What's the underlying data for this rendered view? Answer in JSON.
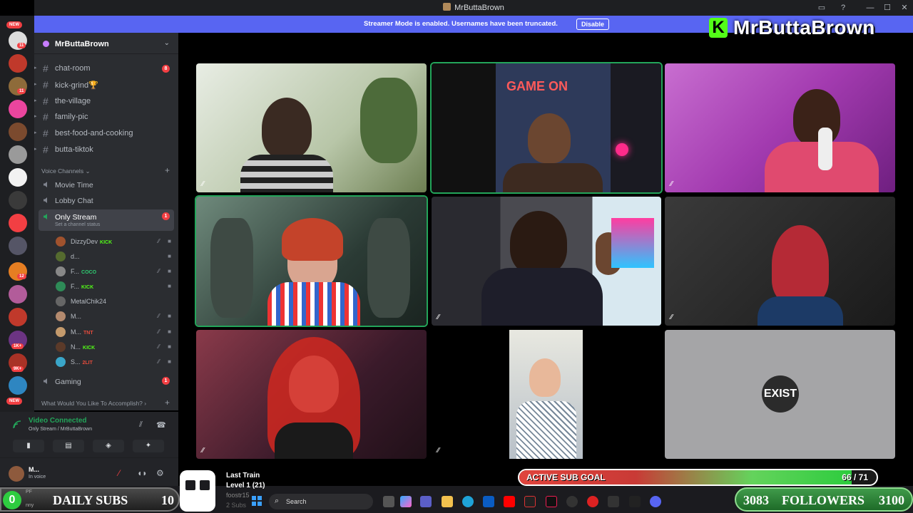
{
  "window": {
    "title": "MrButtaBrown"
  },
  "banner": {
    "message": "Streamer Mode is enabled. Usernames have been truncated.",
    "button": "Disable"
  },
  "brand": {
    "logo_letter": "K",
    "name": "MrButtaBrown",
    "color": "#53fc18"
  },
  "rail": {
    "badges": [
      "NEW",
      "11",
      "11",
      "1",
      "4",
      "5",
      "5",
      "4",
      "8",
      "12",
      "1K+",
      "9K+",
      "NEW"
    ]
  },
  "guild": {
    "name": "MrButtaBrown"
  },
  "text_channels": [
    {
      "name": "chat-room",
      "unread": "8"
    },
    {
      "name": "kick-grind🏆"
    },
    {
      "name": "the-village"
    },
    {
      "name": "family-pic"
    },
    {
      "name": "best-food-and-cooking"
    },
    {
      "name": "butta-tiktok"
    }
  ],
  "voice_category": "Voice Channels",
  "voice_channels": [
    {
      "name": "Movie Time"
    },
    {
      "name": "Lobby Chat"
    },
    {
      "name": "Only Stream",
      "status": "Set a channel status",
      "count": "1"
    }
  ],
  "voice_users": [
    {
      "name": "DizzyDev",
      "tag": "KICK",
      "tag_color": "#53fc18"
    },
    {
      "name": "d...",
      "tag": ""
    },
    {
      "name": "F...",
      "tag": "COCO",
      "tag_color": "#2ecc71"
    },
    {
      "name": "F...",
      "tag": "KICK",
      "tag_color": "#53fc18"
    },
    {
      "name": "MetalChik24",
      "tag": ""
    },
    {
      "name": "M...",
      "tag": ""
    },
    {
      "name": "M...",
      "tag": "TNT",
      "tag_color": "#e74c3c"
    },
    {
      "name": "N...",
      "tag": "KICK",
      "tag_color": "#53fc18"
    },
    {
      "name": "S...",
      "tag": "2LIT",
      "tag_color": "#e74c3c"
    }
  ],
  "gaming_channel": {
    "name": "Gaming",
    "count": "1"
  },
  "accomplish_category": "What Would You Like To Accomplish?",
  "voice_panel": {
    "status": "Video Connected",
    "location": "Only Stream / MrButtaBrown"
  },
  "user_panel": {
    "name": "M...",
    "status": "In voice"
  },
  "daily_subs": {
    "count": "0",
    "label": "DAILY SUBS",
    "goal": "10",
    "sublabel_left": "PF",
    "sublabel_bottom": "nny"
  },
  "last_train": {
    "title": "Last Train",
    "level": "Level 1  (21)",
    "user": "foostr15",
    "subs": "2 Subs"
  },
  "taskbar": {
    "search_placeholder": "Search"
  },
  "sub_goal": {
    "label": "ACTIVE SUB GOAL",
    "current": "66",
    "total": "71",
    "display": "66 / 71",
    "progress": 0.93
  },
  "followers": {
    "current": "3083",
    "label": "FOLLOWERS",
    "goal": "3100"
  },
  "tile_text": {
    "gameon": "GAME ON",
    "exist": "EXIST"
  }
}
